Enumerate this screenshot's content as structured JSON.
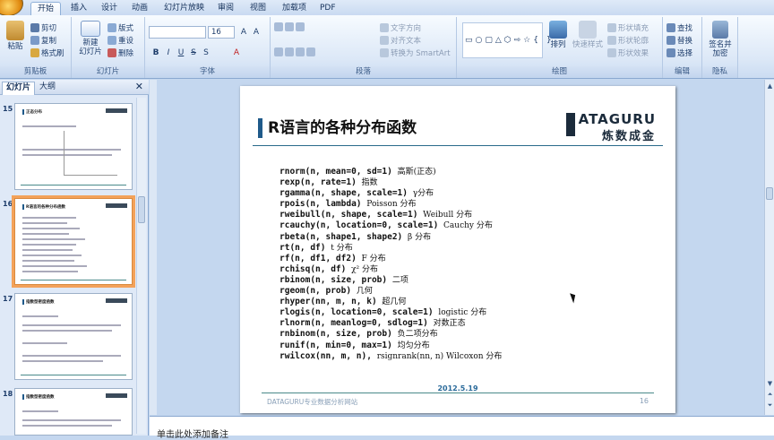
{
  "tabs": [
    "开始",
    "插入",
    "设计",
    "动画",
    "幻灯片放映",
    "审阅",
    "视图",
    "加载项",
    "PDF"
  ],
  "ribbon": {
    "clipboard": {
      "paste": "粘贴",
      "cut": "剪切",
      "copy": "复制",
      "format_painter": "格式刷",
      "label": "剪贴板"
    },
    "slides": {
      "new_slide_1": "新建",
      "new_slide_2": "幻灯片",
      "layout": "版式",
      "reset": "重设",
      "delete": "删除",
      "label": "幻灯片"
    },
    "font": {
      "name_value": "",
      "size_value": "16",
      "label": "字体",
      "bold": "B",
      "italic": "I",
      "underline": "U",
      "strike": "S",
      "shadow": "S"
    },
    "paragraph": {
      "text_direction": "文字方向",
      "align_text": "对齐文本",
      "smartart": "转换为 SmartArt",
      "label": "段落"
    },
    "drawing": {
      "arrange": "排列",
      "quick_styles": "快速样式",
      "shape_fill": "形状填充",
      "shape_outline": "形状轮廓",
      "shape_effects": "形状效果",
      "label": "绘图"
    },
    "editing": {
      "find": "查找",
      "replace": "替换",
      "select": "选择",
      "label": "编辑"
    },
    "privacy": {
      "sign_encrypt_1": "签名并",
      "sign_encrypt_2": "加密",
      "label": "隐私"
    }
  },
  "panel": {
    "tab_slides": "幻灯片",
    "tab_outline": "大纲",
    "close": "✕"
  },
  "thumbnails": [
    {
      "num": "15",
      "title": "正态分布"
    },
    {
      "num": "16",
      "title": "R语言的各种分布函数"
    },
    {
      "num": "17",
      "title": "指数型密度函数"
    },
    {
      "num": "18",
      "title": "指数型密度函数"
    }
  ],
  "slide": {
    "title": "R语言的各种分布函数",
    "logo_top": "ATAGURU",
    "logo_bottom": "炼数成金",
    "code": [
      {
        "c": "rnorm(n, mean=0, sd=1)",
        "d": "高斯(正态)"
      },
      {
        "c": "rexp(n, rate=1)",
        "d": "指数"
      },
      {
        "c": "rgamma(n, shape, scale=1)",
        "d": "γ分布"
      },
      {
        "c": "rpois(n, lambda)",
        "d": "Poisson 分布"
      },
      {
        "c": "rweibull(n, shape, scale=1)",
        "d": "Weibull 分布"
      },
      {
        "c": "rcauchy(n, location=0, scale=1)",
        "d": "Cauchy 分布"
      },
      {
        "c": "rbeta(n, shape1, shape2)",
        "d": "β 分布"
      },
      {
        "c": "rt(n, df)",
        "d": "t 分布"
      },
      {
        "c": "rf(n, df1, df2)",
        "d": "F 分布"
      },
      {
        "c": "rchisq(n, df)",
        "d": "χ² 分布"
      },
      {
        "c": "rbinom(n, size, prob)",
        "d": "二项"
      },
      {
        "c": "rgeom(n, prob)",
        "d": "几何"
      },
      {
        "c": "rhyper(nn, m, n, k)",
        "d": "超几何"
      },
      {
        "c": "rlogis(n, location=0, scale=1)",
        "d": "logistic 分布"
      },
      {
        "c": "rlnorm(n, meanlog=0, sdlog=1)",
        "d": "对数正态"
      },
      {
        "c": "rnbinom(n, size, prob)",
        "d": "负二项分布"
      },
      {
        "c": "runif(n, min=0, max=1)",
        "d": "均匀分布"
      },
      {
        "c": "rwilcox(nn, m, n),",
        "d": "rsignrank(nn, n) Wilcoxon 分布"
      }
    ],
    "date": "2012.5.19",
    "footer": "DATAGURU专业数据分析网站",
    "page": "16"
  },
  "notes_placeholder": "单击此处添加备注",
  "colors": {
    "accent": "#1f5a8a",
    "selection": "#f3a25a",
    "ribbon": "#dce8f7"
  }
}
